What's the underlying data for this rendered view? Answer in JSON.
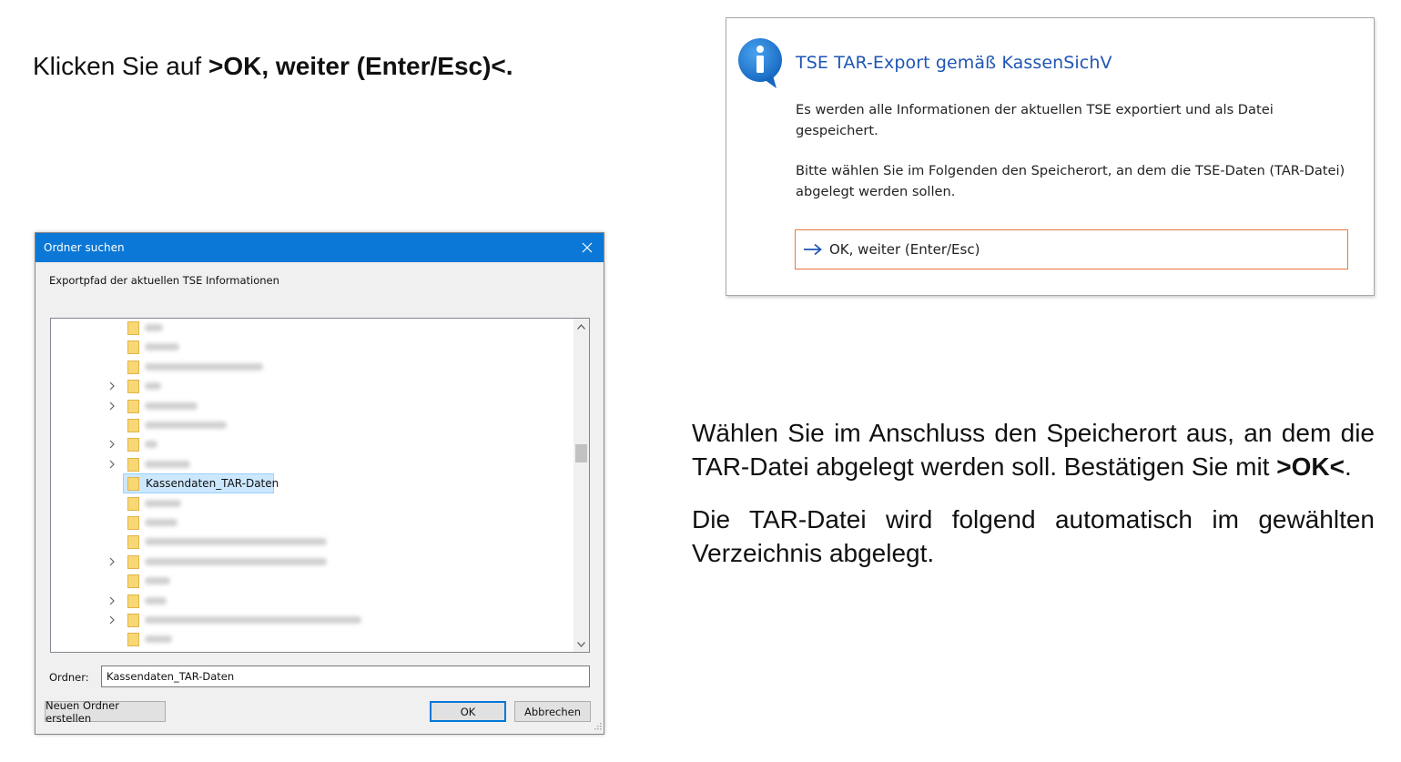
{
  "instructions": {
    "top_prefix": "Klicken Sie auf ",
    "top_bold": ">OK, weiter (Enter/Esc)<.",
    "right_p1_text": "Wählen Sie im Anschluss den Speicherort aus, an dem die TAR-Datei abgelegt werden soll. Bestätigen Sie mit ",
    "right_p1_bold": ">OK<",
    "right_p1_end": ".",
    "right_p2": "Die TAR-Datei wird folgend automatisch im gewählten Verzeichnis abgelegt."
  },
  "message_box": {
    "icon": "info-icon",
    "title": "TSE TAR-Export gemäß KassenSichV",
    "body_1": "Es werden alle Informationen der aktuellen TSE exportiert und als Datei gespeichert.",
    "body_2": "Bitte wählen Sie im Folgenden den Speicherort, an dem die TSE-Daten (TAR-Datei) abgelegt werden sollen.",
    "ok_button_label": "OK, weiter (Enter/Esc)",
    "ok_button_icon": "arrow-right-icon",
    "accent_color": "#1f56b5",
    "button_border_color": "#e8793a"
  },
  "folder_dialog": {
    "title": "Ordner suchen",
    "close_icon": "close-icon",
    "description": "Exportpfad der aktuellen TSE Informationen",
    "titlebar_color": "#0b78d7",
    "tree_items": [
      {
        "label": "",
        "blurred": true,
        "expandable": false
      },
      {
        "label": "",
        "blurred": true,
        "expandable": false
      },
      {
        "label": "",
        "blurred": true,
        "expandable": false
      },
      {
        "label": "",
        "blurred": true,
        "expandable": true
      },
      {
        "label": "",
        "blurred": true,
        "expandable": true
      },
      {
        "label": "",
        "blurred": true,
        "expandable": false
      },
      {
        "label": "",
        "blurred": true,
        "expandable": true
      },
      {
        "label": "",
        "blurred": true,
        "expandable": true
      },
      {
        "label": "Kassendaten_TAR-Daten",
        "blurred": false,
        "expandable": false,
        "selected": true
      },
      {
        "label": "",
        "blurred": true,
        "expandable": false
      },
      {
        "label": "",
        "blurred": true,
        "expandable": false
      },
      {
        "label": "",
        "blurred": true,
        "expandable": false
      },
      {
        "label": "",
        "blurred": true,
        "expandable": true
      },
      {
        "label": "",
        "blurred": true,
        "expandable": false
      },
      {
        "label": "",
        "blurred": true,
        "expandable": true
      },
      {
        "label": "",
        "blurred": true,
        "expandable": true
      },
      {
        "label": "",
        "blurred": true,
        "expandable": false
      }
    ],
    "ordner_label": "Ordner:",
    "ordner_value": "Kassendaten_TAR-Daten",
    "new_folder_button": "Neuen Ordner erstellen",
    "ok_button": "OK",
    "cancel_button": "Abbrechen"
  }
}
